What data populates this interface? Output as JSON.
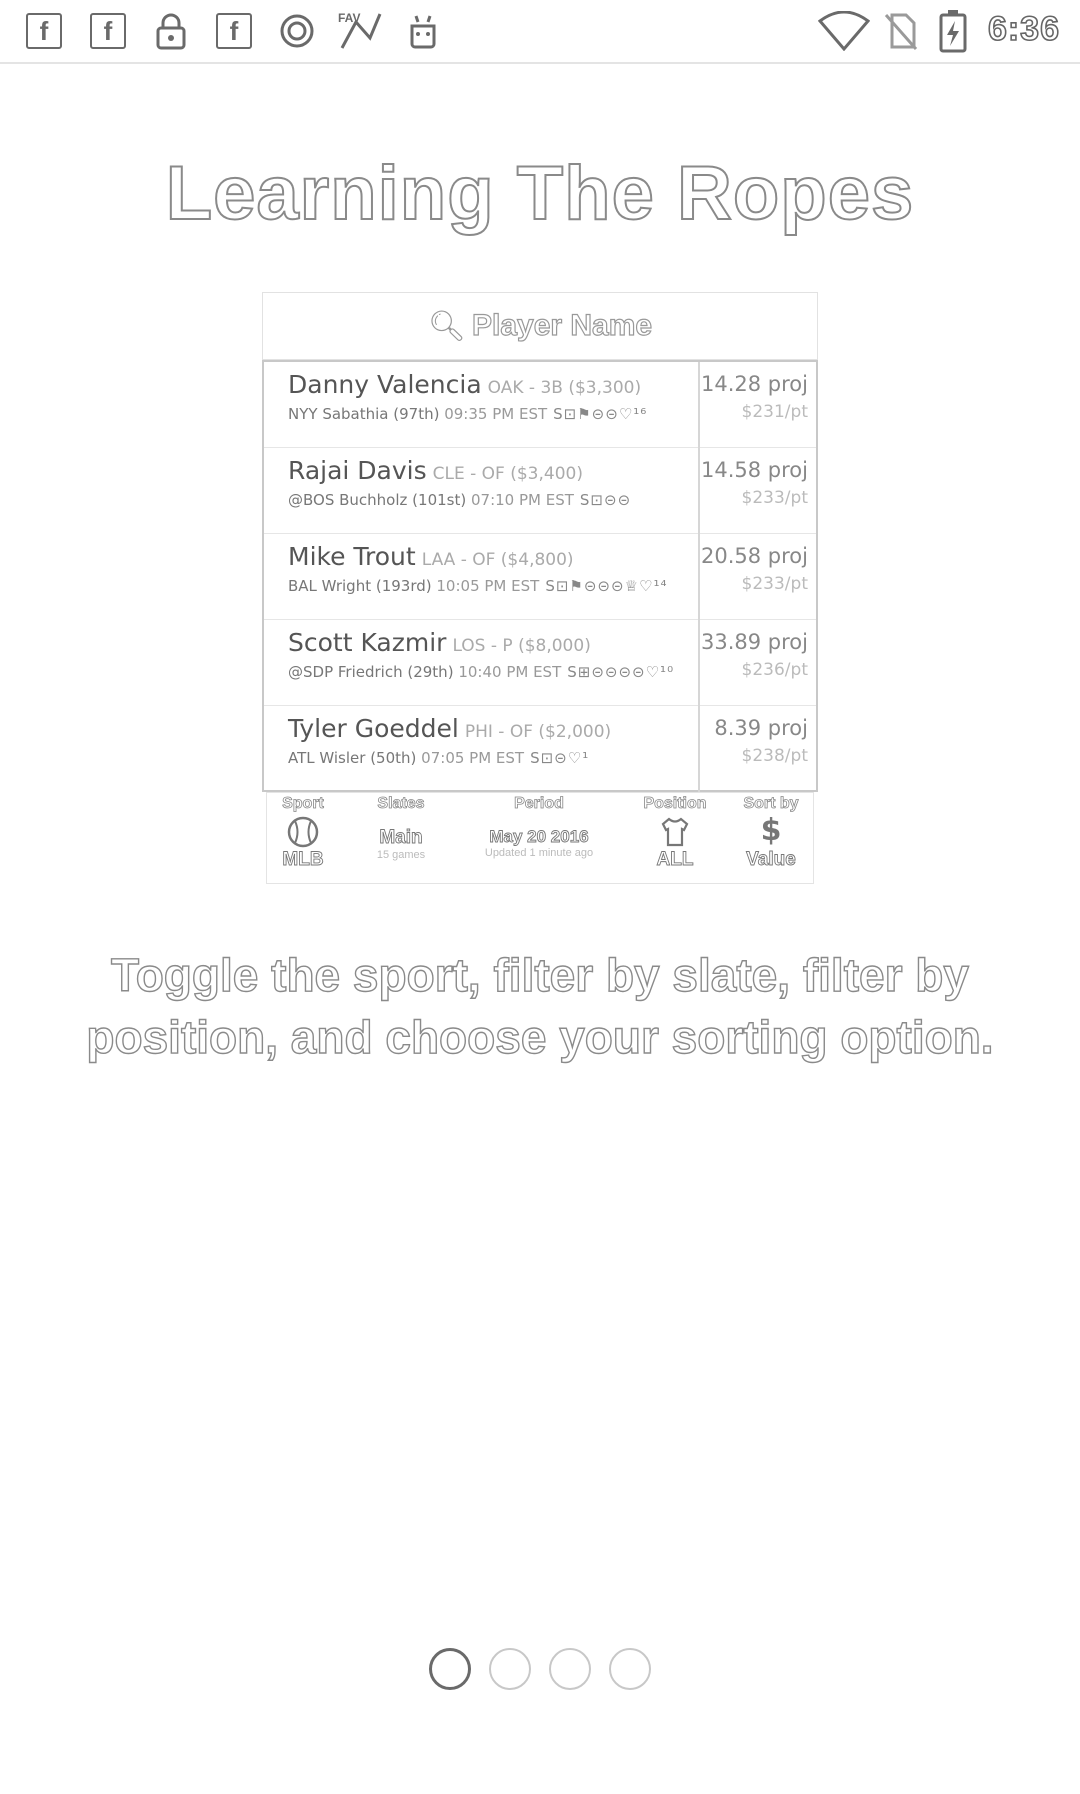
{
  "status_bar": {
    "time": "6:36",
    "left_icons": [
      "facebook-icon",
      "facebook-icon",
      "lock-icon",
      "facebook-icon",
      "record-icon",
      "fantasy-app-icon",
      "android-icon"
    ],
    "right_icons": [
      "wifi-icon",
      "no-sim-icon",
      "battery-charging-icon"
    ]
  },
  "title": "Learning The Ropes",
  "preview": {
    "search_placeholder": "Player Name",
    "players": [
      {
        "name": "Danny Valencia",
        "meta": "OAK - 3B ($3,300)",
        "opponent": "NYY Sabathia (97th)",
        "time": "09:35 PM EST",
        "glyphs": "S⊡⚑⊝⊝♡¹⁶",
        "proj": "14.28 proj",
        "ppt": "$231/pt"
      },
      {
        "name": "Rajai Davis",
        "meta": "CLE - OF ($3,400)",
        "opponent": "@BOS Buchholz (101st)",
        "time": "07:10 PM EST",
        "glyphs": "S⊡⊝⊝",
        "proj": "14.58 proj",
        "ppt": "$233/pt"
      },
      {
        "name": "Mike Trout",
        "meta": "LAA - OF ($4,800)",
        "opponent": "BAL Wright (193rd)",
        "time": "10:05 PM EST",
        "glyphs": "S⊡⚑⊝⊝⊝♕♡¹⁴",
        "proj": "20.58 proj",
        "ppt": "$233/pt"
      },
      {
        "name": "Scott Kazmir",
        "meta": "LOS - P ($8,000)",
        "opponent": "@SDP Friedrich (29th)",
        "time": "10:40 PM EST",
        "glyphs": "S⊞⊝⊝⊝⊝♡¹⁰",
        "proj": "33.89 proj",
        "ppt": "$236/pt"
      },
      {
        "name": "Tyler Goeddel",
        "meta": "PHI - OF ($2,000)",
        "opponent": "ATL Wisler (50th)",
        "time": "07:05 PM EST",
        "glyphs": "S⊡⊝♡¹",
        "proj": "8.39 proj",
        "ppt": "$238/pt"
      }
    ],
    "filters": {
      "sport": {
        "header": "Sport",
        "value": "MLB",
        "icon": "baseball-icon"
      },
      "slates": {
        "header": "Slates",
        "value": "Main",
        "sub": "15 games"
      },
      "period": {
        "header": "Period",
        "value": "May 20 2016",
        "sub": "Updated 1 minute ago"
      },
      "position": {
        "header": "Position",
        "value": "ALL",
        "icon": "jersey-icon"
      },
      "sortby": {
        "header": "Sort by",
        "value": "Value",
        "icon": "dollar-icon"
      }
    }
  },
  "description": "Toggle the sport, filter by slate, filter by position, and choose your sorting option.",
  "pager": {
    "count": 4,
    "active": 0
  }
}
